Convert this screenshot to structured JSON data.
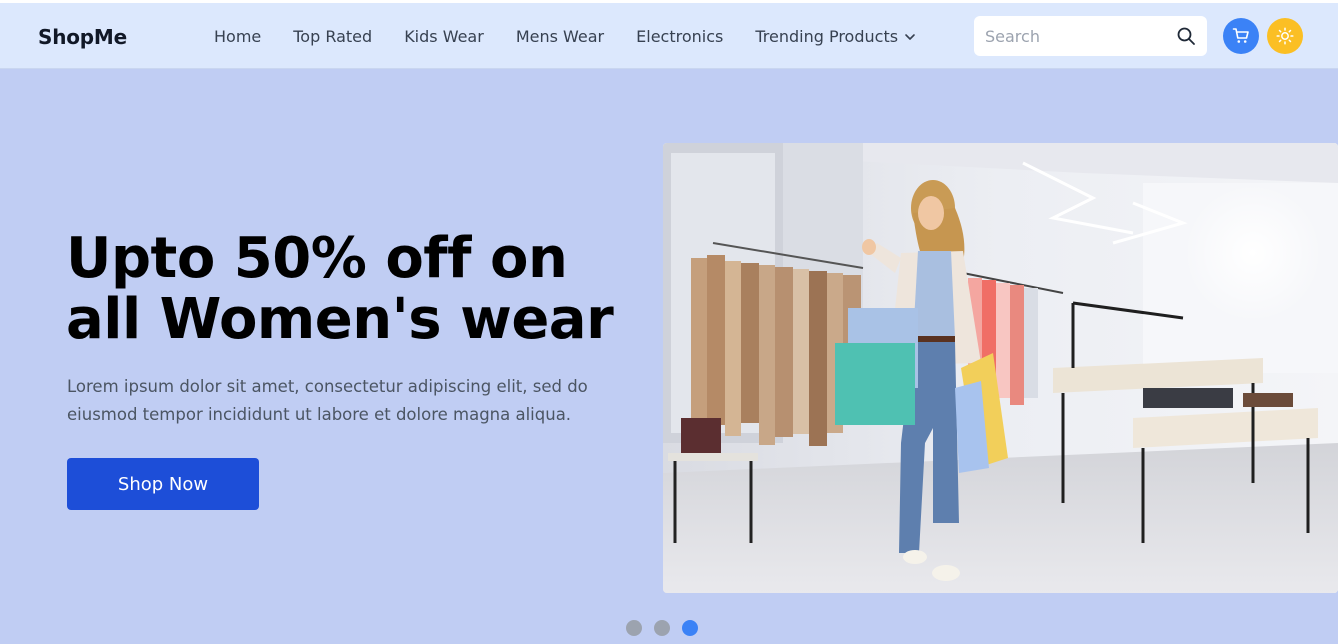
{
  "brand": {
    "name": "ShopMe"
  },
  "nav": {
    "links": [
      {
        "label": "Home"
      },
      {
        "label": "Top Rated"
      },
      {
        "label": "Kids Wear"
      },
      {
        "label": "Mens Wear"
      },
      {
        "label": "Electronics"
      },
      {
        "label": "Trending Products"
      }
    ]
  },
  "search": {
    "placeholder": "Search",
    "value": ""
  },
  "icons": {
    "search": "search-icon",
    "cart": "cart-icon",
    "theme": "sun-icon",
    "dropdown": "chevron-down-icon"
  },
  "hero": {
    "title": "Upto 50% off on all Women's wear",
    "description": "Lorem ipsum dolor sit amet, consectetur adipiscing elit, sed do eiusmod tempor incididunt ut labore et dolore magna aliqua.",
    "button_label": "Shop Now",
    "image_alt": "Woman with shopping bags in clothing store"
  },
  "carousel": {
    "total": 3,
    "active_index": 3
  },
  "colors": {
    "page_bg": "#c0cdf3",
    "navbar_bg": "#dce8fd",
    "accent": "#1d4ed8",
    "cart_button": "#3b82f6",
    "theme_button": "#fbbf24"
  }
}
